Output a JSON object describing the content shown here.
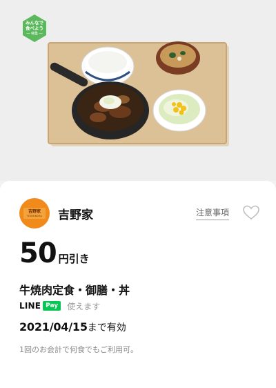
{
  "hero": {
    "badge": {
      "line1": "みんなで",
      "line2": "食べよう",
      "line3": "― 特集 ―",
      "color": "#5cb85c"
    },
    "image_icon": "gyudon-set-meal-illustration"
  },
  "coupon": {
    "brand": {
      "logo_text": "吉野家",
      "logo_subtext": "YOSHINOYA",
      "name": "吉野家",
      "logo_color": "#f08a1a"
    },
    "notes_label": "注意事項",
    "favorite_icon": "heart-outline-icon",
    "discount": {
      "amount": "50",
      "suffix": "円引き"
    },
    "menu_items": "牛焼肉定食・御膳・丼",
    "payment": {
      "line_text": "LINE",
      "pay_text": "Pay",
      "usable_text": "使えます",
      "brand_color": "#06c755"
    },
    "validity": {
      "date": "2021/04/15",
      "suffix": "まで有効"
    },
    "condition": "1回のお会計で何食でもご利用可。"
  }
}
